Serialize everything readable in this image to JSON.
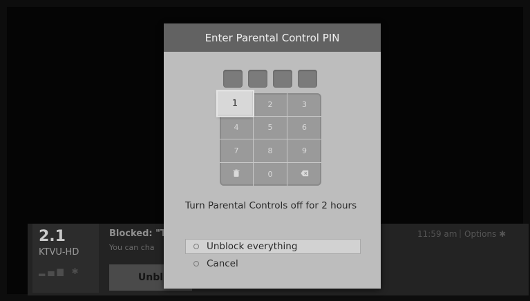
{
  "background": {
    "channel_number": "2.1",
    "channel_name": "KTVU-HD",
    "blocked_title": "Blocked: \"T",
    "blocked_subtitle": "You can cha",
    "unblock_button_label": "Unbl",
    "time": "11:59 am",
    "separator": "|",
    "options_label": "Options ✱"
  },
  "dialog": {
    "title": "Enter Parental Control PIN",
    "pin_slots": 4,
    "keypad": [
      {
        "label": "1",
        "name": "key-1"
      },
      {
        "label": "2",
        "name": "key-2"
      },
      {
        "label": "3",
        "name": "key-3"
      },
      {
        "label": "4",
        "name": "key-4"
      },
      {
        "label": "5",
        "name": "key-5"
      },
      {
        "label": "6",
        "name": "key-6"
      },
      {
        "label": "7",
        "name": "key-7"
      },
      {
        "label": "8",
        "name": "key-8"
      },
      {
        "label": "9",
        "name": "key-9"
      },
      {
        "label": "",
        "name": "key-clear",
        "icon": "trash-icon"
      },
      {
        "label": "0",
        "name": "key-0"
      },
      {
        "label": "",
        "name": "key-backspace",
        "icon": "backspace-icon"
      }
    ],
    "focused_key": "1",
    "prompt": "Turn Parental Controls off for 2 hours",
    "options": [
      {
        "label": "Unblock everything",
        "selected": true
      },
      {
        "label": "Cancel",
        "selected": false
      }
    ]
  },
  "colors": {
    "dialog_background": "#bdbdbd",
    "header_background": "#626262",
    "keypad_background": "#9a9a9a"
  }
}
